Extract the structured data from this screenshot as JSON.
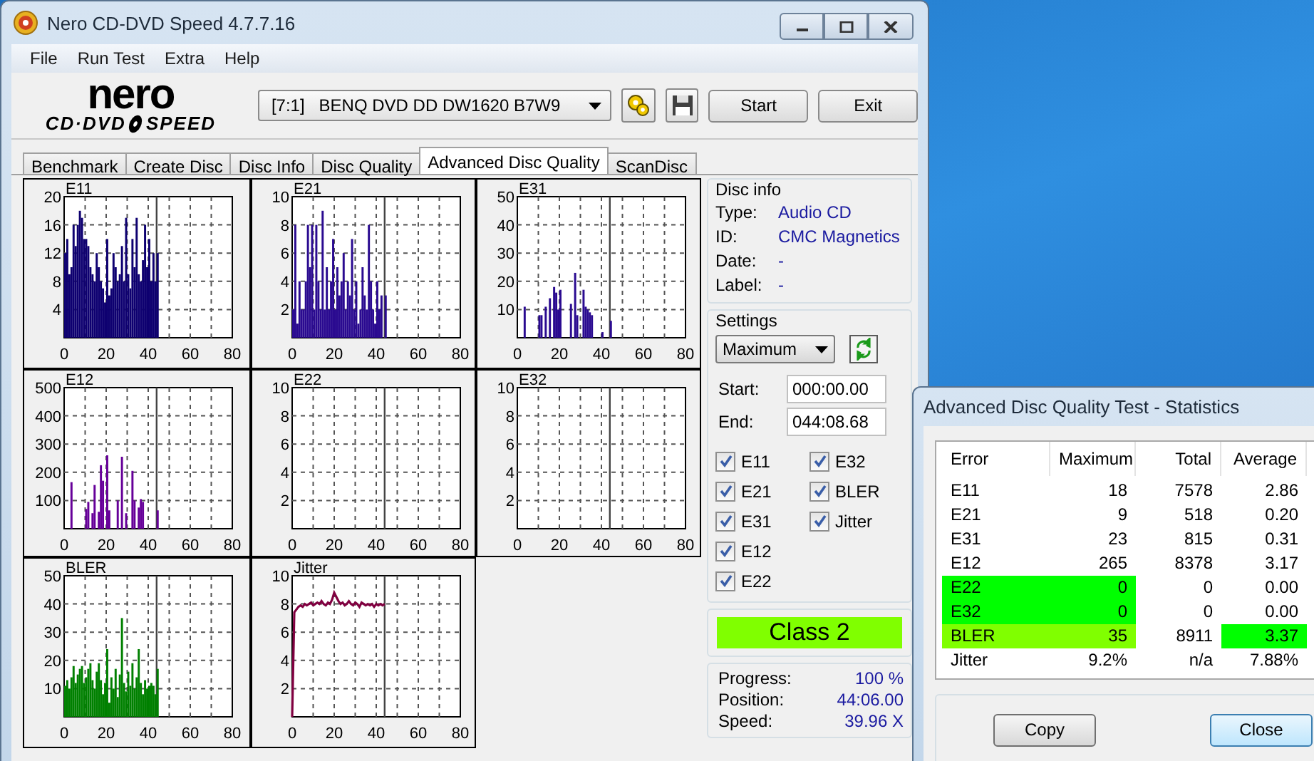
{
  "window": {
    "title": "Nero CD-DVD Speed 4.7.7.16"
  },
  "menu": [
    "File",
    "Run Test",
    "Extra",
    "Help"
  ],
  "logo": {
    "word": "nero",
    "line_left": "CD·DVD",
    "line_right": "SPEED"
  },
  "drive": {
    "value": "[7:1]   BENQ DVD DD DW1620 B7W9"
  },
  "buttons": [
    "Start",
    "Exit"
  ],
  "tabs": [
    {
      "label": "Benchmark",
      "selected": false
    },
    {
      "label": "Create Disc",
      "selected": false
    },
    {
      "label": "Disc Info",
      "selected": false
    },
    {
      "label": "Disc Quality",
      "selected": false
    },
    {
      "label": "Advanced Disc Quality",
      "selected": true
    },
    {
      "label": "ScanDisc",
      "selected": false
    }
  ],
  "charts": [
    {
      "chart_data": {
        "type": "bar",
        "title": "E11",
        "grid": true,
        "xlim": [
          0,
          80
        ],
        "ylim": [
          0,
          20
        ],
        "xticks": [
          0,
          20,
          40,
          60,
          80
        ],
        "yticks": [
          4,
          8,
          12,
          16,
          20
        ],
        "ref_lines": [
          {
            "axis": "x",
            "value": 44
          }
        ],
        "x": [
          0,
          1,
          2,
          3,
          4,
          5,
          6,
          7,
          8,
          9,
          10,
          11,
          12,
          13,
          14,
          15,
          16,
          17,
          18,
          19,
          20,
          21,
          22,
          23,
          24,
          25,
          26,
          27,
          28,
          29,
          30,
          31,
          32,
          33,
          34,
          35,
          36,
          37,
          38,
          39,
          40,
          41,
          42,
          43,
          44
        ],
        "series": [
          {
            "color": "#0e0070",
            "values": [
              12,
              14,
              9,
              10,
              16,
              13,
              16,
              18,
              17,
              14,
              14,
              13,
              10,
              9,
              8,
              12,
              10,
              8,
              7,
              5,
              14,
              6,
              7,
              12,
              10,
              8,
              9,
              13,
              8,
              17,
              9,
              7,
              14,
              10,
              17,
              9,
              8,
              11,
              16,
              10,
              14,
              8,
              12,
              8,
              12
            ]
          }
        ]
      }
    },
    {
      "chart_data": {
        "type": "bar",
        "title": "E21",
        "grid": true,
        "xlim": [
          0,
          80
        ],
        "ylim": [
          0,
          10
        ],
        "xticks": [
          0,
          20,
          40,
          60,
          80
        ],
        "yticks": [
          2,
          4,
          6,
          8,
          10
        ],
        "ref_lines": [
          {
            "axis": "x",
            "value": 44
          }
        ],
        "x": [
          0,
          1,
          2,
          3,
          4,
          5,
          6,
          7,
          8,
          9,
          10,
          11,
          12,
          13,
          14,
          15,
          16,
          17,
          18,
          19,
          20,
          21,
          22,
          23,
          24,
          25,
          26,
          27,
          28,
          29,
          30,
          31,
          32,
          33,
          34,
          35,
          36,
          37,
          38,
          39,
          40,
          41,
          42,
          43,
          44
        ],
        "series": [
          {
            "color": "#2a0a90",
            "values": [
              2,
              8,
              1,
              4,
              2,
              2,
              4,
              8,
              5,
              8,
              2,
              8,
              4,
              2,
              9,
              2,
              5,
              2,
              4,
              7,
              2,
              5,
              3,
              4,
              6,
              2,
              4,
              3,
              7,
              2,
              4,
              1,
              2,
              5,
              3,
              2,
              8,
              4,
              2,
              1,
              4,
              2,
              3,
              0,
              3
            ]
          }
        ]
      }
    },
    {
      "chart_data": {
        "type": "bar",
        "title": "E31",
        "grid": true,
        "xlim": [
          0,
          80
        ],
        "ylim": [
          0,
          50
        ],
        "xticks": [
          0,
          20,
          40,
          60,
          80
        ],
        "yticks": [
          10,
          20,
          30,
          40,
          50
        ],
        "ref_lines": [
          {
            "axis": "x",
            "value": 44
          }
        ],
        "x": [
          0,
          1,
          2,
          3,
          4,
          5,
          6,
          7,
          8,
          9,
          10,
          11,
          12,
          13,
          14,
          15,
          16,
          17,
          18,
          19,
          20,
          21,
          22,
          23,
          24,
          25,
          26,
          27,
          28,
          29,
          30,
          31,
          32,
          33,
          34,
          35,
          36,
          37,
          38,
          39,
          40,
          41,
          42,
          43,
          44
        ],
        "series": [
          {
            "color": "#2a0a90",
            "values": [
              0,
              0,
              0,
              11,
              0,
              0,
              0,
              0,
              0,
              0,
              8,
              8,
              0,
              11,
              0,
              14,
              0,
              18,
              16,
              10,
              17,
              0,
              0,
              0,
              0,
              12,
              0,
              23,
              8,
              0,
              0,
              17,
              11,
              10,
              9,
              8,
              0,
              0,
              0,
              0,
              2,
              0,
              0,
              0,
              6
            ]
          }
        ]
      }
    },
    {
      "chart_data": {
        "type": "bar",
        "title": "E12",
        "grid": true,
        "xlim": [
          0,
          80
        ],
        "ylim": [
          0,
          500
        ],
        "xticks": [
          0,
          20,
          40,
          60,
          80
        ],
        "yticks": [
          100,
          200,
          300,
          400,
          500
        ],
        "ref_lines": [
          {
            "axis": "x",
            "value": 44
          }
        ],
        "x": [
          0,
          1,
          2,
          3,
          4,
          5,
          6,
          7,
          8,
          9,
          10,
          11,
          12,
          13,
          14,
          15,
          16,
          17,
          18,
          19,
          20,
          21,
          22,
          23,
          24,
          25,
          26,
          27,
          28,
          29,
          30,
          31,
          32,
          33,
          34,
          35,
          36,
          37,
          38,
          39,
          40,
          41,
          42,
          43,
          44
        ],
        "series": [
          {
            "color": "#660099",
            "values": [
              0,
              0,
              0,
              165,
              0,
              0,
              0,
              0,
              0,
              0,
              70,
              95,
              0,
              55,
              155,
              0,
              60,
              225,
              170,
              0,
              260,
              65,
              0,
              0,
              0,
              100,
              0,
              255,
              0,
              55,
              0,
              0,
              205,
              100,
              0,
              75,
              105,
              95,
              0,
              0,
              0,
              0,
              0,
              0,
              65
            ]
          }
        ]
      }
    },
    {
      "chart_data": {
        "type": "bar",
        "title": "E22",
        "grid": true,
        "xlim": [
          0,
          80
        ],
        "ylim": [
          0,
          10
        ],
        "xticks": [
          0,
          20,
          40,
          60,
          80
        ],
        "yticks": [
          2,
          4,
          6,
          8,
          10
        ],
        "ref_lines": [
          {
            "axis": "x",
            "value": 44
          }
        ],
        "x": [
          0,
          1,
          2,
          3,
          4,
          5,
          6,
          7,
          8,
          9,
          10,
          11,
          12,
          13,
          14,
          15,
          16,
          17,
          18,
          19,
          20,
          21,
          22,
          23,
          24,
          25,
          26,
          27,
          28,
          29,
          30,
          31,
          32,
          33,
          34,
          35,
          36,
          37,
          38,
          39,
          40,
          41,
          42,
          43,
          44
        ],
        "series": [
          {
            "values": [
              0,
              0,
              0,
              0,
              0,
              0,
              0,
              0,
              0,
              0,
              0,
              0,
              0,
              0,
              0,
              0,
              0,
              0,
              0,
              0,
              0,
              0,
              0,
              0,
              0,
              0,
              0,
              0,
              0,
              0,
              0,
              0,
              0,
              0,
              0,
              0,
              0,
              0,
              0,
              0,
              0,
              0,
              0,
              0,
              0
            ]
          }
        ]
      }
    },
    {
      "chart_data": {
        "type": "bar",
        "title": "E32",
        "grid": true,
        "xlim": [
          0,
          80
        ],
        "ylim": [
          0,
          10
        ],
        "xticks": [
          0,
          20,
          40,
          60,
          80
        ],
        "yticks": [
          2,
          4,
          6,
          8,
          10
        ],
        "ref_lines": [
          {
            "axis": "x",
            "value": 44
          }
        ],
        "x": [
          0,
          1,
          2,
          3,
          4,
          5,
          6,
          7,
          8,
          9,
          10,
          11,
          12,
          13,
          14,
          15,
          16,
          17,
          18,
          19,
          20,
          21,
          22,
          23,
          24,
          25,
          26,
          27,
          28,
          29,
          30,
          31,
          32,
          33,
          34,
          35,
          36,
          37,
          38,
          39,
          40,
          41,
          42,
          43,
          44
        ],
        "series": [
          {
            "values": [
              0,
              0,
              0,
              0,
              0,
              0,
              0,
              0,
              0,
              0,
              0,
              0,
              0,
              0,
              0,
              0,
              0,
              0,
              0,
              0,
              0,
              0,
              0,
              0,
              0,
              0,
              0,
              0,
              0,
              0,
              0,
              0,
              0,
              0,
              0,
              0,
              0,
              0,
              0,
              0,
              0,
              0,
              0,
              0,
              0
            ]
          }
        ]
      }
    },
    {
      "chart_data": {
        "type": "bar",
        "title": "BLER",
        "grid": true,
        "xlim": [
          0,
          80
        ],
        "ylim": [
          0,
          50
        ],
        "xticks": [
          0,
          20,
          40,
          60,
          80
        ],
        "yticks": [
          10,
          20,
          30,
          40,
          50
        ],
        "ref_lines": [
          {
            "axis": "x",
            "value": 44
          }
        ],
        "x": [
          0,
          1,
          2,
          3,
          4,
          5,
          6,
          7,
          8,
          9,
          10,
          11,
          12,
          13,
          14,
          15,
          16,
          17,
          18,
          19,
          20,
          21,
          22,
          23,
          24,
          25,
          26,
          27,
          28,
          29,
          30,
          31,
          32,
          33,
          34,
          35,
          36,
          37,
          38,
          39,
          40,
          41,
          42,
          43,
          44
        ],
        "series": [
          {
            "color": "#008000",
            "values": [
              11,
              13,
              10,
              14,
              18,
              12,
              15,
              17,
              18,
              12,
              14,
              17,
              19,
              13,
              10,
              16,
              19,
              13,
              8,
              12,
              24,
              5,
              14,
              10,
              17,
              7,
              15,
              35,
              12,
              9,
              16,
              11,
              19,
              10,
              14,
              24,
              12,
              8,
              13,
              10,
              11,
              12,
              11,
              8,
              17
            ]
          }
        ]
      }
    },
    {
      "chart_data": {
        "type": "line",
        "title": "Jitter",
        "grid": true,
        "xlim": [
          0,
          80
        ],
        "ylim": [
          0,
          10
        ],
        "xticks": [
          0,
          20,
          40,
          60,
          80
        ],
        "yticks": [
          2,
          4,
          6,
          8,
          10
        ],
        "ref_lines": [
          {
            "axis": "x",
            "value": 44
          }
        ],
        "x": [
          0,
          1,
          2,
          3,
          4,
          5,
          6,
          7,
          8,
          9,
          10,
          11,
          12,
          13,
          14,
          15,
          16,
          17,
          18,
          19,
          20,
          21,
          22,
          23,
          24,
          25,
          26,
          27,
          28,
          29,
          30,
          31,
          32,
          33,
          34,
          35,
          36,
          37,
          38,
          39,
          40,
          41,
          42,
          43,
          44
        ],
        "series": [
          {
            "color": "#800040",
            "values": [
              0,
              7.4,
              7.6,
              7.8,
              7.9,
              7.8,
              8.0,
              7.9,
              8.0,
              8.1,
              7.9,
              8.0,
              8.1,
              8.0,
              8.2,
              8.0,
              7.9,
              8.1,
              8.0,
              8.3,
              8.8,
              8.5,
              8.2,
              8.0,
              8.1,
              7.9,
              8.0,
              8.2,
              8.0,
              7.9,
              8.1,
              8.0,
              7.8,
              8.1,
              8.0,
              7.9,
              8.0,
              7.9,
              8.0,
              7.8,
              8.0,
              7.9,
              8.0,
              7.9,
              8.0
            ]
          }
        ]
      }
    }
  ],
  "disc_info": {
    "title": "Disc info",
    "rows": [
      {
        "label": "Type:",
        "value": "Audio CD"
      },
      {
        "label": "ID:",
        "value": "CMC Magnetics"
      },
      {
        "label": "Date:",
        "value": "-"
      },
      {
        "label": "Label:",
        "value": "-"
      }
    ]
  },
  "settings": {
    "title": "Settings",
    "mode": "Maximum",
    "start_label": "Start:",
    "start": "000:00.00",
    "end_label": "End:",
    "end": "044:08.68",
    "checks": [
      {
        "label": "E11",
        "checked": true
      },
      {
        "label": "E21",
        "checked": true
      },
      {
        "label": "E31",
        "checked": true
      },
      {
        "label": "E12",
        "checked": true
      },
      {
        "label": "E22",
        "checked": true
      },
      {
        "label": "E32",
        "checked": true
      },
      {
        "label": "BLER",
        "checked": true
      },
      {
        "label": "Jitter",
        "checked": true
      }
    ]
  },
  "class_badge": {
    "text": "Class 2"
  },
  "progress": [
    {
      "label": "Progress:",
      "value": "100 %"
    },
    {
      "label": "Position:",
      "value": "44:06.00"
    },
    {
      "label": "Speed:",
      "value": "39.96 X"
    }
  ],
  "stats_window": {
    "title": "Advanced Disc Quality Test - Statistics",
    "columns": [
      "Error",
      "Maximum",
      "Total",
      "Average"
    ],
    "rows": [
      {
        "cells": [
          {
            "text": "E11"
          },
          {
            "text": "18"
          },
          {
            "text": "7578"
          },
          {
            "text": "2.86"
          }
        ]
      },
      {
        "cells": [
          {
            "text": "E21"
          },
          {
            "text": "9"
          },
          {
            "text": "518"
          },
          {
            "text": "0.20"
          }
        ]
      },
      {
        "cells": [
          {
            "text": "E31"
          },
          {
            "text": "23"
          },
          {
            "text": "815"
          },
          {
            "text": "0.31"
          }
        ]
      },
      {
        "cells": [
          {
            "text": "E12"
          },
          {
            "text": "265"
          },
          {
            "text": "8378"
          },
          {
            "text": "3.17"
          }
        ]
      },
      {
        "cells": [
          {
            "text": "E22",
            "color": "#00ff00"
          },
          {
            "text": "0",
            "color": "#00ff00"
          },
          {
            "text": "0"
          },
          {
            "text": "0.00"
          }
        ]
      },
      {
        "cells": [
          {
            "text": "E32",
            "color": "#00ff00"
          },
          {
            "text": "0",
            "color": "#00ff00"
          },
          {
            "text": "0"
          },
          {
            "text": "0.00"
          }
        ]
      },
      {
        "cells": [
          {
            "text": "BLER",
            "color": "#80ff00"
          },
          {
            "text": "35",
            "color": "#80ff00"
          },
          {
            "text": "8911"
          },
          {
            "text": "3.37",
            "color": "#00ff00"
          }
        ]
      },
      {
        "cells": [
          {
            "text": "Jitter"
          },
          {
            "text": "9.2%"
          },
          {
            "text": "n/a"
          },
          {
            "text": "7.88%"
          }
        ]
      }
    ],
    "buttons": [
      {
        "label": "Copy",
        "default": false
      },
      {
        "label": "Close",
        "default": true
      }
    ]
  }
}
